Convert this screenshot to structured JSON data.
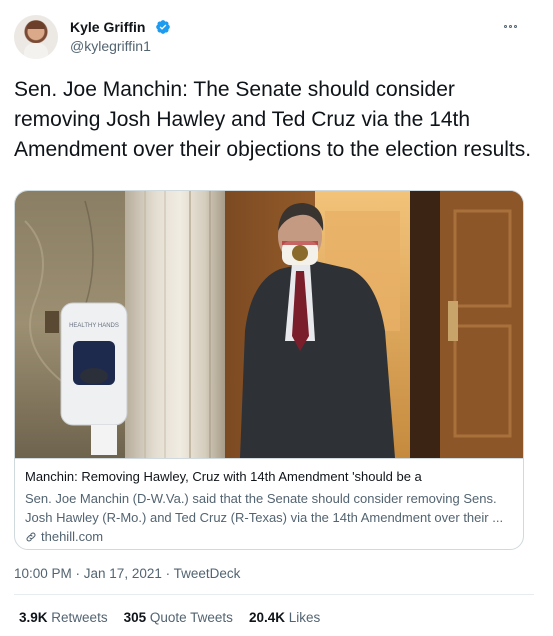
{
  "author": {
    "name": "Kyle Griffin",
    "handle": "@kylegriffin1",
    "verified": true
  },
  "tweet": {
    "text": "Sen. Joe Manchin: The Senate should consider removing Josh Hawley and Ted Cruz via the 14th Amendment over their objections to the election results."
  },
  "card": {
    "sign_text": "HEALTHY HANDS",
    "title": "Manchin: Removing Hawley, Cruz with 14th Amendment 'should be a",
    "description": "Sen. Joe Manchin (D-W.Va.) said that the Senate should consider removing Sens. Josh Hawley (R-Mo.) and Ted Cruz (R-Texas) via the 14th Amendment over their ...",
    "domain": "thehill.com"
  },
  "meta": {
    "timestamp": "10:00 PM · Jan 17, 2021 · TweetDeck"
  },
  "stats": {
    "retweets_count": "3.9K",
    "retweets_label": "Retweets",
    "quotes_count": "305",
    "quotes_label": "Quote Tweets",
    "likes_count": "20.4K",
    "likes_label": "Likes"
  },
  "colors": {
    "verified_blue": "#1d9bf0",
    "secondary_text": "#536471",
    "border": "#cfd9de"
  },
  "icons": [
    "verified-badge-icon",
    "more-options-icon",
    "link-icon"
  ]
}
